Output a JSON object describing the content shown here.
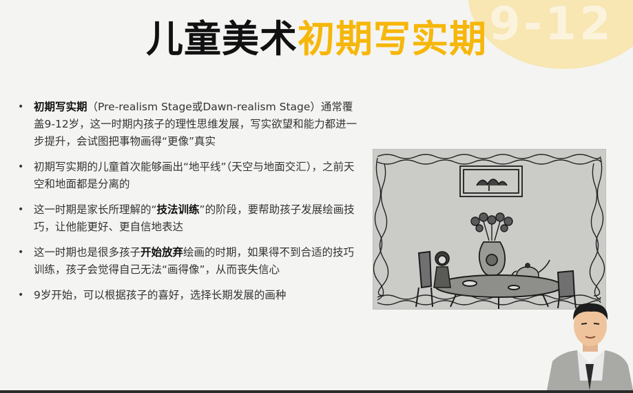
{
  "slide": {
    "decor_age": "9-12",
    "title_main": "儿童美术",
    "title_highlight": "初期写实期"
  },
  "bullets": [
    {
      "segments": [
        {
          "text": "初期写实期",
          "bold": true
        },
        {
          "text": "（Pre-realism Stage或Dawn-realism Stage）通常覆盖9-12岁，这一时期内孩子的理性思维发展，写实欲望和能力都进一步提升，会试图把事物画得“更像”真实",
          "bold": false
        }
      ]
    },
    {
      "segments": [
        {
          "text": "初期写实期的儿童首次能够画出“地平线”（天空与地面交汇），之前天空和地面都是分离的",
          "bold": false
        }
      ]
    },
    {
      "segments": [
        {
          "text": "这一时期是家长所理解的“",
          "bold": false
        },
        {
          "text": "技法训练",
          "bold": true
        },
        {
          "text": "”的阶段，要帮助孩子发展绘画技巧，让他能更好、更自信地表达",
          "bold": false
        }
      ]
    },
    {
      "segments": [
        {
          "text": "这一时期也是很多孩子",
          "bold": false
        },
        {
          "text": "开始放弃",
          "bold": true
        },
        {
          "text": "绘画的时期，如果得不到合适的技巧训练，孩子会觉得自己无法“画得像”，从而丧失信心",
          "bold": false
        }
      ]
    },
    {
      "segments": [
        {
          "text": "9岁开始，可以根据孩子的喜好，选择长期发展的画种",
          "bold": false
        }
      ]
    }
  ],
  "drawing": {
    "icon": "child-drawing-image"
  },
  "presenter": {
    "icon": "presenter-video-overlay"
  },
  "colors": {
    "accent": "#f6b70a",
    "decor": "#f8e6b3",
    "text": "#333333",
    "background": "#f4f4f2"
  }
}
